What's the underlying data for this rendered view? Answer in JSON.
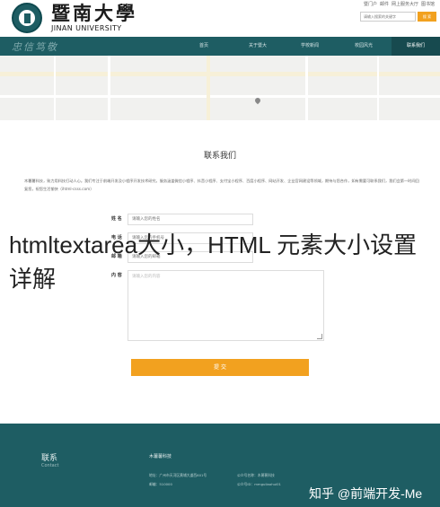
{
  "header": {
    "logo_cn": "暨南大學",
    "logo_en": "JINAN UNIVERSITY",
    "top_links": [
      "暨门户",
      "邮件",
      "网上服务大厅",
      "图书馆"
    ],
    "search_placeholder": "请输入搜索的关键字",
    "search_button": "搜 索"
  },
  "nav": {
    "motto": "忠信笃敬",
    "items": [
      "首页",
      "关于暨大",
      "学校新闻",
      "校园风光",
      "联系我们"
    ],
    "active_index": 4
  },
  "contact": {
    "title": "联系我们",
    "intro": "木薯薯科技，致力用科技打动人心。我们专注于前端开发及小程序开发技术研究，服务涵盖微信小程序、抖音小程序、支付宝小程序、百度小程序、网站开发、企业官网建设等领域，期待与您合作，如有需要可联系我们，我们会第一时间回复您，祝您生活愉快（ihtml-csss.com）",
    "form": {
      "name_label": "姓 名",
      "name_placeholder": "请输入您的姓名",
      "phone_label": "电 话",
      "phone_placeholder": "请输入您的手机号",
      "email_label": "邮 箱",
      "email_placeholder": "请输入您的邮箱",
      "content_label": "内 容",
      "content_placeholder": "请输入您的内容",
      "submit_label": "提 交"
    }
  },
  "overlay_caption": "htmltextarea大小，HTML 元素大小设置详解",
  "footer": {
    "title": "联系",
    "subtitle": "Contact",
    "company": "木薯薯科技",
    "address": "地址：广州市天河区黄埔大道西601号",
    "postcode": "邮编：510000",
    "wechat_name": "公众号名称：木薯薯科技",
    "wechat_id": "公众号ID：mmguliaohui01"
  },
  "watermark": "知乎 @前端开发-Me"
}
